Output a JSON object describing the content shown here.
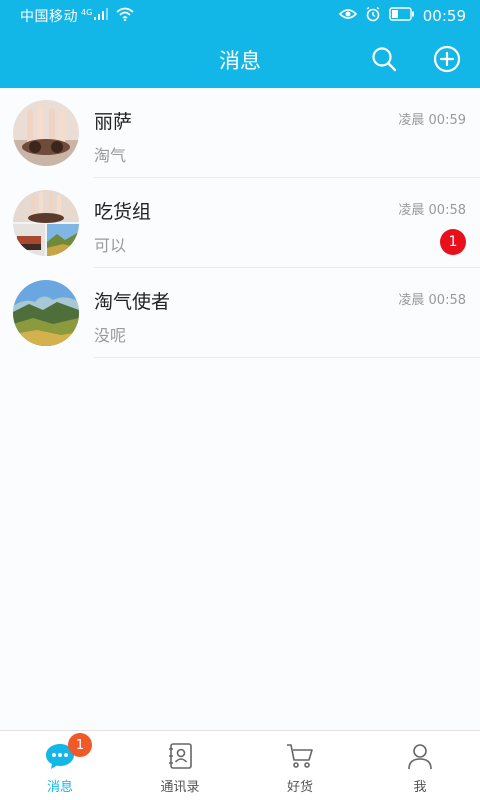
{
  "status_bar": {
    "carrier": "中国移动",
    "network": "4G",
    "time": "00:59",
    "icons": [
      "signal-icon",
      "wifi-icon",
      "eye-icon",
      "alarm-icon",
      "battery-icon"
    ]
  },
  "header": {
    "title": "消息",
    "actions": [
      "search-icon",
      "add-circle-icon"
    ]
  },
  "conversations": [
    {
      "name": "丽萨",
      "last_message": "淘气",
      "time": "凌晨 00:59",
      "unread": ""
    },
    {
      "name": "吃货组",
      "last_message": "可以",
      "time": "凌晨 00:58",
      "unread": "1"
    },
    {
      "name": "淘气使者",
      "last_message": "没呢",
      "time": "凌晨 00:58",
      "unread": ""
    }
  ],
  "tabbar": {
    "tabs": [
      {
        "label": "消息",
        "icon": "chat-bubble-icon",
        "active": true,
        "badge": "1"
      },
      {
        "label": "通讯录",
        "icon": "contacts-book-icon",
        "active": false,
        "badge": ""
      },
      {
        "label": "好货",
        "icon": "shopping-cart-icon",
        "active": false,
        "badge": ""
      },
      {
        "label": "我",
        "icon": "person-icon",
        "active": false,
        "badge": ""
      }
    ]
  },
  "colors": {
    "accent": "#12b7e8",
    "unread_badge": "#e8101b",
    "tab_badge": "#f05a28"
  }
}
